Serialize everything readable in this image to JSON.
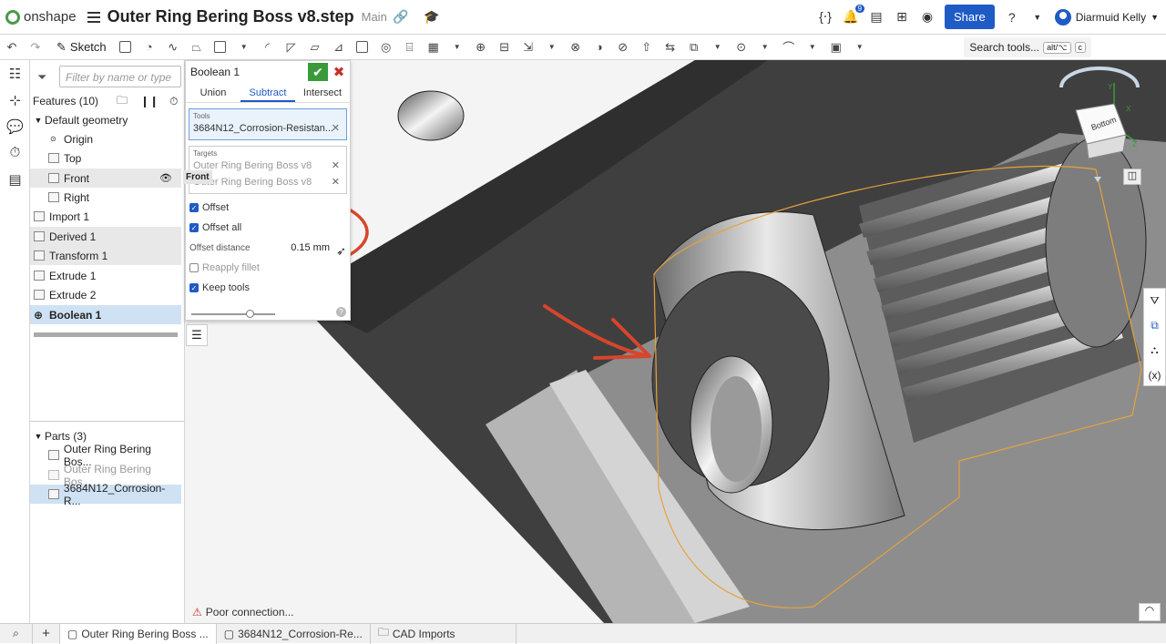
{
  "app": {
    "logo_text": "onshape"
  },
  "header": {
    "doc_title": "Outer Ring Bering Boss v8.step",
    "branch": "Main",
    "share_label": "Share",
    "notification_count": "9",
    "user_name": "Diarmuid Kelly",
    "accent_color": "#1f5bc4"
  },
  "toolbar": {
    "sketch_label": "Sketch",
    "search_label": "Search tools...",
    "search_shortcut1": "alt/⌥",
    "search_shortcut2": "c"
  },
  "features": {
    "filter_placeholder": "Filter by name or type",
    "header_label": "Features (10)",
    "items": [
      {
        "label": "Default geometry"
      },
      {
        "label": "Origin"
      },
      {
        "label": "Top"
      },
      {
        "label": "Front"
      },
      {
        "label": "Right"
      },
      {
        "label": "Import 1"
      },
      {
        "label": "Derived 1"
      },
      {
        "label": "Transform 1"
      },
      {
        "label": "Extrude 1"
      },
      {
        "label": "Extrude 2"
      },
      {
        "label": "Boolean 1"
      }
    ],
    "front_tooltip": "Front",
    "parts_header": "Parts (3)",
    "parts": [
      {
        "label": "Outer Ring Bering Bos..."
      },
      {
        "label": "Outer Ring Bering Bos..."
      },
      {
        "label": "3684N12_Corrosion-R..."
      }
    ]
  },
  "boolean_panel": {
    "title": "Boolean 1",
    "tabs": [
      "Union",
      "Subtract",
      "Intersect"
    ],
    "tools_label": "Tools",
    "tools_value": "3684N12_Corrosion-Resistan...",
    "targets_label": "Targets",
    "targets": [
      "Outer Ring Bering Boss v8",
      "Outer Ring Bering Boss v8"
    ],
    "offset_label": "Offset",
    "offset_all_label": "Offset all",
    "offset_distance_label": "Offset distance",
    "offset_distance_value": "0.15 mm",
    "reapply_fillet_label": "Reapply fillet",
    "keep_tools_label": "Keep tools",
    "offset_checked": true,
    "offset_all_checked": true,
    "reapply_fillet_checked": false,
    "keep_tools_checked": true
  },
  "viewcube": {
    "face_label": "Bottom",
    "axis_x": "X",
    "axis_y": "Y",
    "axis_z": "Z"
  },
  "status": {
    "connection": "Poor connection..."
  },
  "bottom_tabs": [
    {
      "label": "Outer Ring Bering Boss ..."
    },
    {
      "label": "3684N12_Corrosion-Re..."
    },
    {
      "label": "CAD Imports"
    }
  ]
}
